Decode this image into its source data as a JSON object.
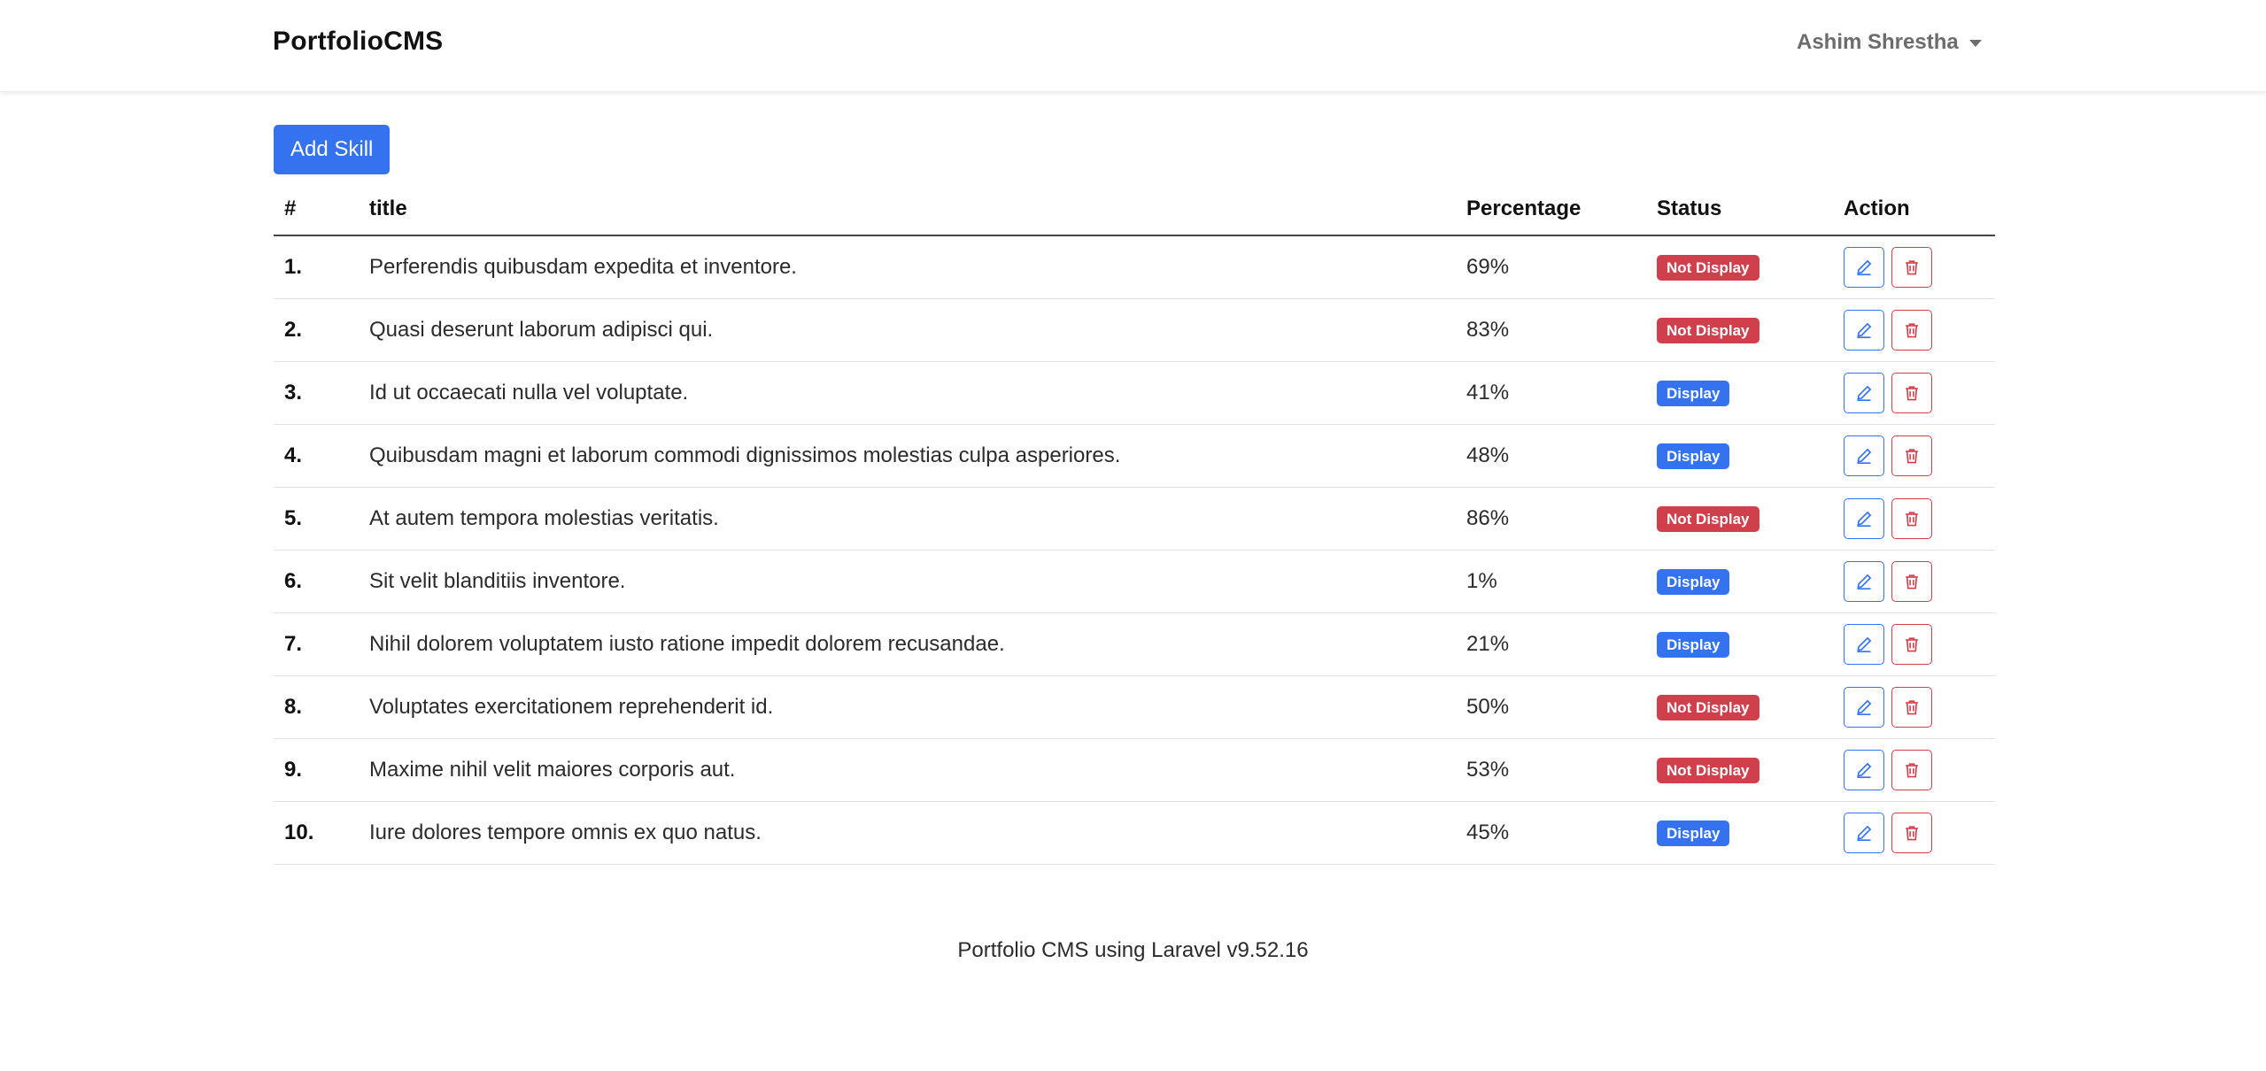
{
  "navbar": {
    "brand": "PortfolioCMS",
    "user_name": "Ashim Shrestha"
  },
  "toolbar": {
    "add_label": "Add Skill"
  },
  "table": {
    "headers": {
      "num": "#",
      "title": "title",
      "percentage": "Percentage",
      "status": "Status",
      "action": "Action"
    },
    "rows": [
      {
        "num": "1.",
        "title": "Perferendis quibusdam expedita et inventore.",
        "percentage": "69%",
        "status": "Not Display"
      },
      {
        "num": "2.",
        "title": "Quasi deserunt laborum adipisci qui.",
        "percentage": "83%",
        "status": "Not Display"
      },
      {
        "num": "3.",
        "title": "Id ut occaecati nulla vel voluptate.",
        "percentage": "41%",
        "status": "Display"
      },
      {
        "num": "4.",
        "title": "Quibusdam magni et laborum commodi dignissimos molestias culpa asperiores.",
        "percentage": "48%",
        "status": "Display"
      },
      {
        "num": "5.",
        "title": "At autem tempora molestias veritatis.",
        "percentage": "86%",
        "status": "Not Display"
      },
      {
        "num": "6.",
        "title": "Sit velit blanditiis inventore.",
        "percentage": "1%",
        "status": "Display"
      },
      {
        "num": "7.",
        "title": "Nihil dolorem voluptatem iusto ratione impedit dolorem recusandae.",
        "percentage": "21%",
        "status": "Display"
      },
      {
        "num": "8.",
        "title": "Voluptates exercitationem reprehenderit id.",
        "percentage": "50%",
        "status": "Not Display"
      },
      {
        "num": "9.",
        "title": "Maxime nihil velit maiores corporis aut.",
        "percentage": "53%",
        "status": "Not Display"
      },
      {
        "num": "10.",
        "title": "Iure dolores tempore omnis ex quo natus.",
        "percentage": "45%",
        "status": "Display"
      }
    ]
  },
  "footer": {
    "text": "Portfolio CMS using Laravel v9.52.16"
  },
  "colors": {
    "primary": "#3472f0",
    "danger": "#d0404c"
  },
  "icons": {
    "edit": "pencil-icon",
    "delete": "trash-icon",
    "user_menu": "chevron-down-icon"
  }
}
